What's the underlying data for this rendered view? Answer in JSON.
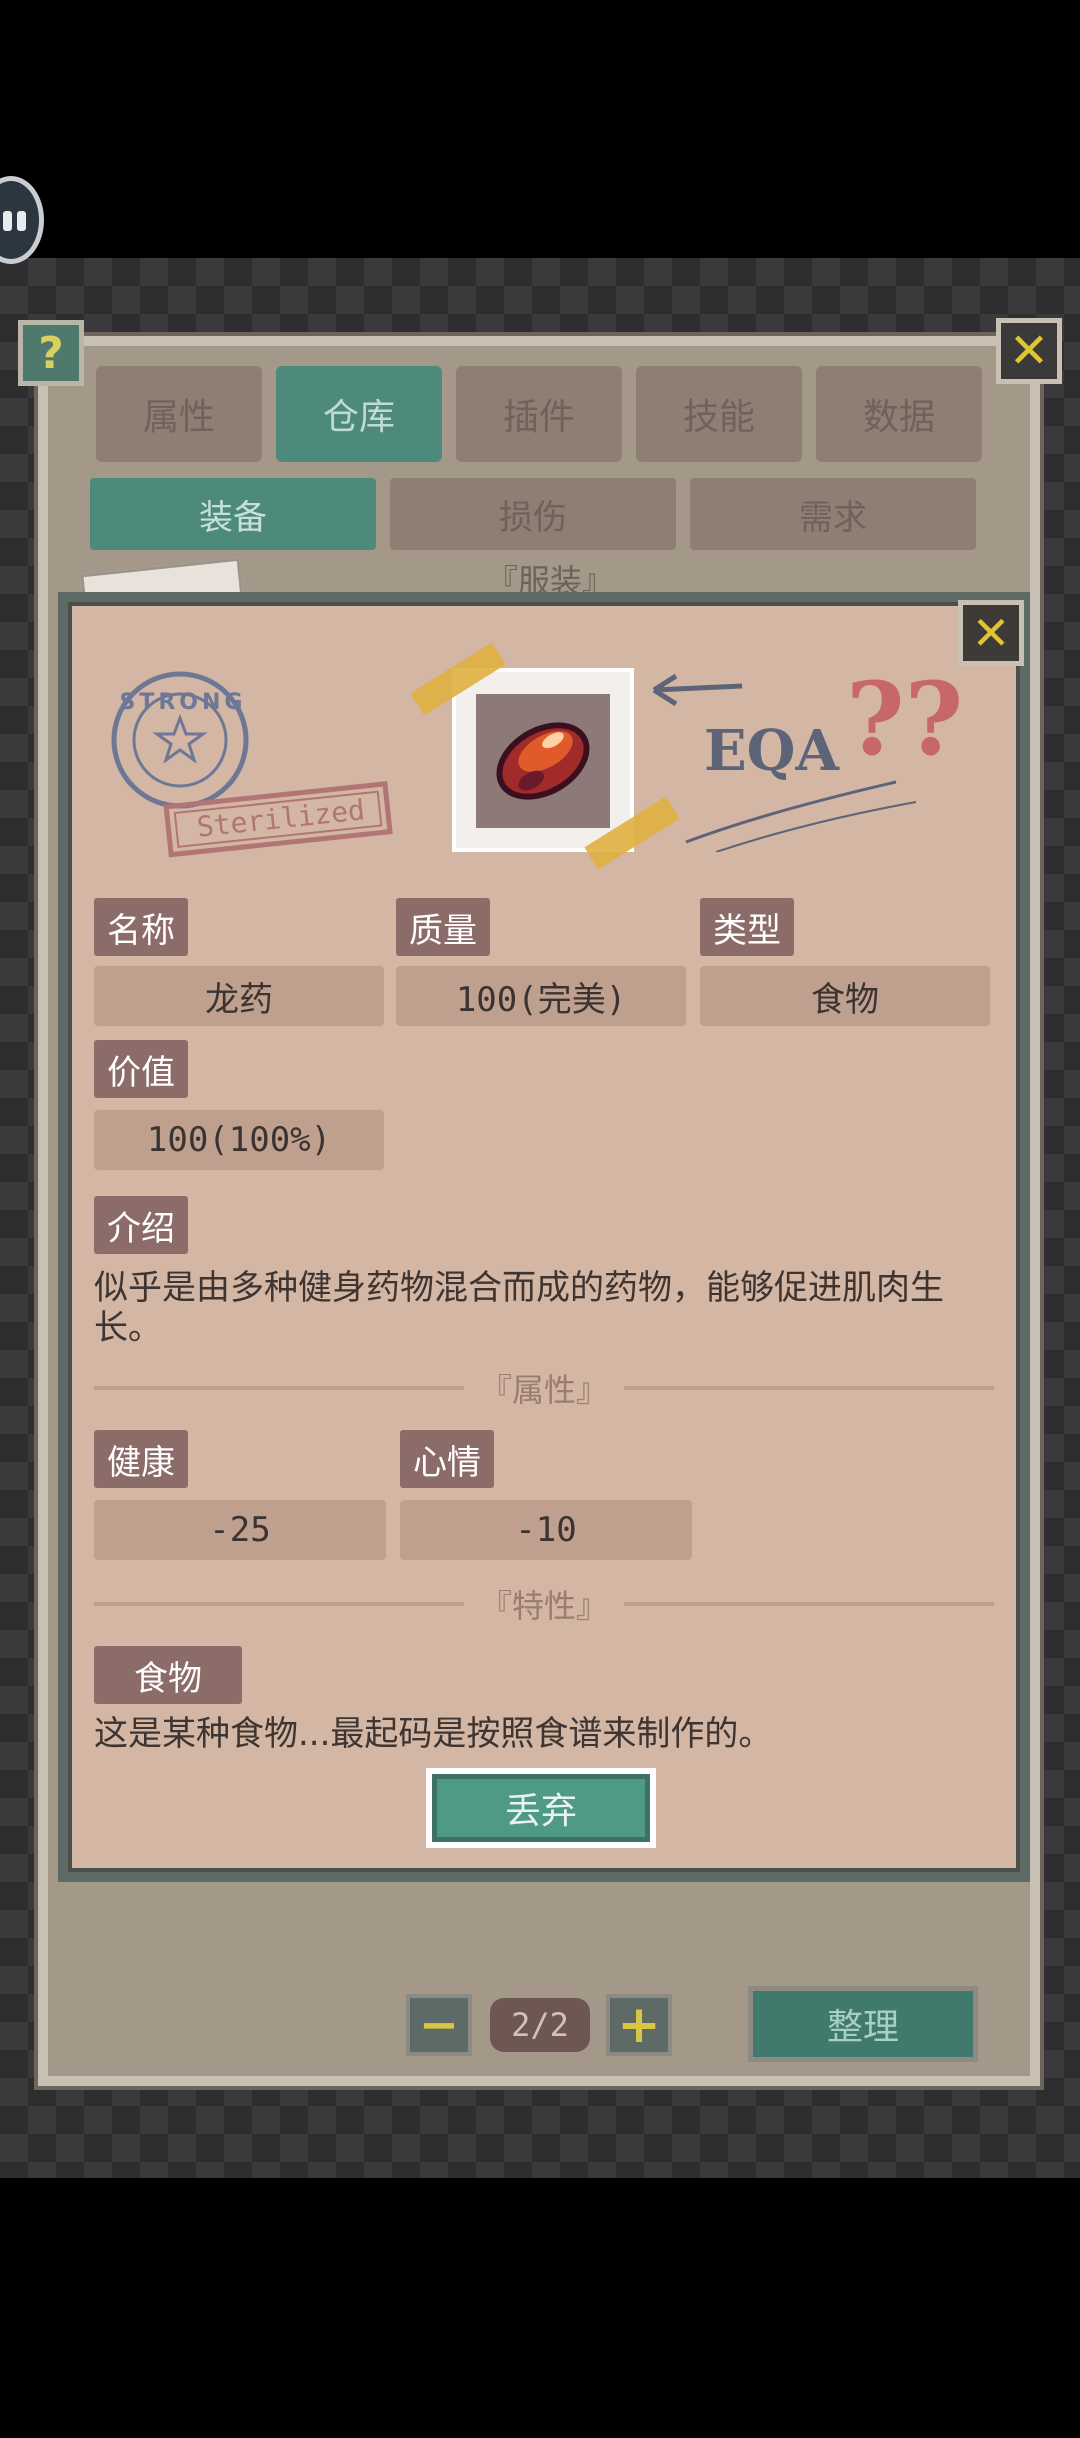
{
  "top_tabs": [
    "属性",
    "仓库",
    "插件",
    "技能",
    "数据"
  ],
  "active_tab_index": 1,
  "sub_tabs": [
    "装备",
    "损伤",
    "需求"
  ],
  "active_sub_tab_index": 0,
  "behind_section_title": "『服装』",
  "help_icon": "?",
  "close_icon": "✕",
  "item": {
    "name_label": "名称",
    "name": "龙药",
    "quality_label": "质量",
    "quality": "100(完美)",
    "type_label": "类型",
    "type": "食物",
    "value_label": "价值",
    "value": "100(100%)",
    "intro_label": "介绍",
    "intro": "似乎是由多种健身药物混合而成的药物，能够促进肌肉生长。",
    "stamp_text": "Sterilized",
    "stamp_circle_text": "STRONG",
    "scribble_text": "EQA",
    "question_marks": "??"
  },
  "attributes_section": "『属性』",
  "attributes": [
    {
      "label": "健康",
      "value": "-25"
    },
    {
      "label": "心情",
      "value": "-10"
    }
  ],
  "traits_section": "『特性』",
  "trait": {
    "label": "食物",
    "description": "这是某种食物...最起码是按照食谱来制作的。"
  },
  "discard_button": "丢弃",
  "pager": {
    "minus": "−",
    "page": "2/2",
    "plus": "+"
  },
  "sort_button": "整理",
  "colors": {
    "accent_green": "#4d8a7c",
    "popup_bg": "#d3b6a3",
    "label_bg": "#8c6c68"
  }
}
